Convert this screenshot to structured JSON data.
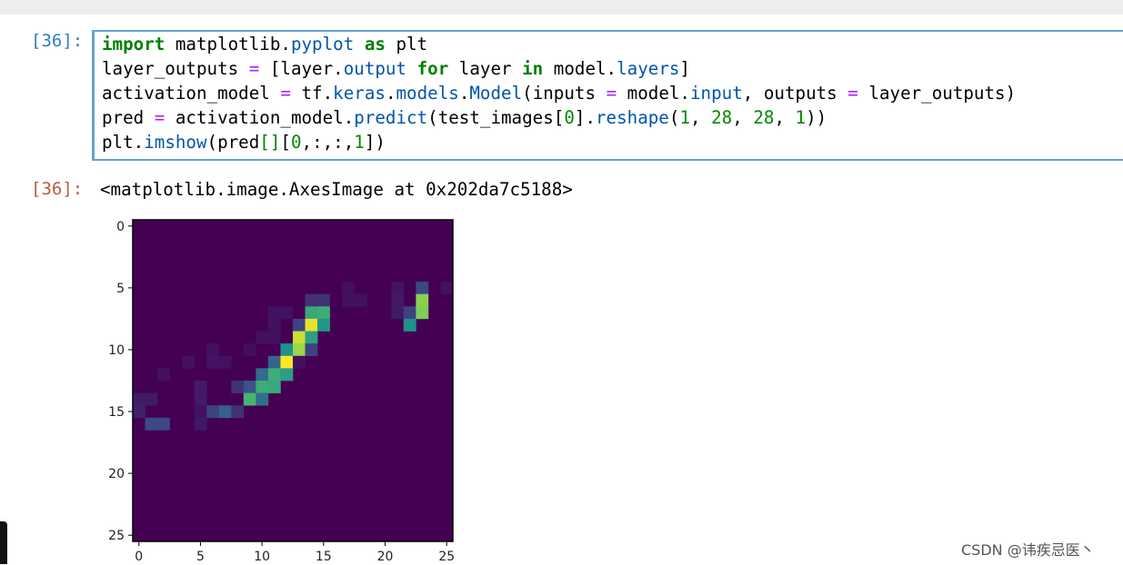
{
  "cell": {
    "input_prompt": "[36]:",
    "output_prompt": "[36]:",
    "code_lines": [
      [
        [
          "import",
          "kw"
        ],
        [
          " matplotlib.",
          "txt"
        ],
        [
          "pyplot",
          "attr"
        ],
        [
          " ",
          "txt"
        ],
        [
          "as",
          "kw"
        ],
        [
          " plt",
          "txt"
        ]
      ],
      [
        [
          "layer_outputs ",
          "txt"
        ],
        [
          "=",
          "op"
        ],
        [
          " [layer.",
          "txt"
        ],
        [
          "output",
          "attr"
        ],
        [
          " ",
          "txt"
        ],
        [
          "for",
          "kw"
        ],
        [
          " layer ",
          "txt"
        ],
        [
          "in",
          "kw"
        ],
        [
          " model.",
          "txt"
        ],
        [
          "layers",
          "attr"
        ],
        [
          "]",
          "txt"
        ]
      ],
      [
        [
          "activation_model ",
          "txt"
        ],
        [
          "=",
          "op"
        ],
        [
          " tf.",
          "txt"
        ],
        [
          "keras",
          "attr"
        ],
        [
          ".",
          "txt"
        ],
        [
          "models",
          "attr"
        ],
        [
          ".",
          "txt"
        ],
        [
          "Model",
          "attr"
        ],
        [
          "(inputs ",
          "txt"
        ],
        [
          "=",
          "op"
        ],
        [
          " model.",
          "txt"
        ],
        [
          "input",
          "attr"
        ],
        [
          ", outputs ",
          "txt"
        ],
        [
          "=",
          "op"
        ],
        [
          " layer_outputs)",
          "txt"
        ]
      ],
      [
        [
          "pred ",
          "txt"
        ],
        [
          "=",
          "op"
        ],
        [
          " activation_model.",
          "txt"
        ],
        [
          "predict",
          "attr"
        ],
        [
          "(test_images[",
          "txt"
        ],
        [
          "0",
          "num"
        ],
        [
          "].",
          "txt"
        ],
        [
          "reshape",
          "attr"
        ],
        [
          "(",
          "txt"
        ],
        [
          "1",
          "num"
        ],
        [
          ", ",
          "txt"
        ],
        [
          "28",
          "num"
        ],
        [
          ", ",
          "txt"
        ],
        [
          "28",
          "num"
        ],
        [
          ", ",
          "txt"
        ],
        [
          "1",
          "num"
        ],
        [
          "))",
          "txt"
        ]
      ],
      [
        [
          "plt.",
          "txt"
        ],
        [
          "imshow",
          "attr"
        ],
        [
          "(pred",
          "txt"
        ],
        [
          "[]",
          "brk"
        ],
        [
          "[",
          "txt"
        ],
        [
          "0",
          "num"
        ],
        [
          ",:,:,",
          "txt"
        ],
        [
          "1",
          "num"
        ],
        [
          "])",
          "txt"
        ]
      ]
    ],
    "output_text": "<matplotlib.image.AxesImage at 0x202da7c5188>"
  },
  "chart_data": {
    "type": "heatmap",
    "colormap": "viridis",
    "shape": [
      26,
      26
    ],
    "vrange": [
      0,
      1
    ],
    "xticks": [
      "0",
      "5",
      "10",
      "15",
      "20",
      "25"
    ],
    "yticks": [
      "0",
      "5",
      "10",
      "15",
      "20",
      "25"
    ],
    "background_value": 0,
    "cells": [
      [
        5,
        17,
        0.04
      ],
      [
        5,
        21,
        0.06
      ],
      [
        5,
        23,
        0.22
      ],
      [
        5,
        25,
        0.05
      ],
      [
        6,
        14,
        0.15
      ],
      [
        6,
        15,
        0.15
      ],
      [
        6,
        17,
        0.05
      ],
      [
        6,
        18,
        0.05
      ],
      [
        6,
        21,
        0.08
      ],
      [
        6,
        23,
        0.82
      ],
      [
        7,
        11,
        0.05
      ],
      [
        7,
        12,
        0.05
      ],
      [
        7,
        14,
        0.6
      ],
      [
        7,
        15,
        0.62
      ],
      [
        7,
        21,
        0.08
      ],
      [
        7,
        22,
        0.2
      ],
      [
        7,
        23,
        0.8
      ],
      [
        8,
        11,
        0.05
      ],
      [
        8,
        13,
        0.2
      ],
      [
        8,
        14,
        0.96
      ],
      [
        8,
        15,
        0.52
      ],
      [
        8,
        22,
        0.5
      ],
      [
        9,
        10,
        0.05
      ],
      [
        9,
        11,
        0.05
      ],
      [
        9,
        13,
        0.92
      ],
      [
        9,
        14,
        0.56
      ],
      [
        10,
        6,
        0.05
      ],
      [
        10,
        9,
        0.04
      ],
      [
        10,
        12,
        0.5
      ],
      [
        10,
        13,
        0.85
      ],
      [
        10,
        14,
        0.2
      ],
      [
        11,
        4,
        0.05
      ],
      [
        11,
        6,
        0.06
      ],
      [
        11,
        7,
        0.05
      ],
      [
        11,
        11,
        0.32
      ],
      [
        11,
        12,
        1.0
      ],
      [
        11,
        13,
        0.05
      ],
      [
        12,
        2,
        0.05
      ],
      [
        12,
        10,
        0.36
      ],
      [
        12,
        11,
        0.62
      ],
      [
        12,
        12,
        0.55
      ],
      [
        13,
        5,
        0.08
      ],
      [
        13,
        8,
        0.15
      ],
      [
        13,
        9,
        0.25
      ],
      [
        13,
        10,
        0.62
      ],
      [
        13,
        11,
        0.6
      ],
      [
        14,
        0,
        0.08
      ],
      [
        14,
        1,
        0.08
      ],
      [
        14,
        5,
        0.08
      ],
      [
        14,
        9,
        0.66
      ],
      [
        14,
        10,
        0.36
      ],
      [
        15,
        0,
        0.1
      ],
      [
        15,
        5,
        0.05
      ],
      [
        15,
        6,
        0.2
      ],
      [
        15,
        7,
        0.3
      ],
      [
        15,
        8,
        0.15
      ],
      [
        16,
        1,
        0.22
      ],
      [
        16,
        2,
        0.22
      ],
      [
        16,
        5,
        0.07
      ]
    ]
  },
  "watermark": "CSDN @讳疾忌医丶"
}
